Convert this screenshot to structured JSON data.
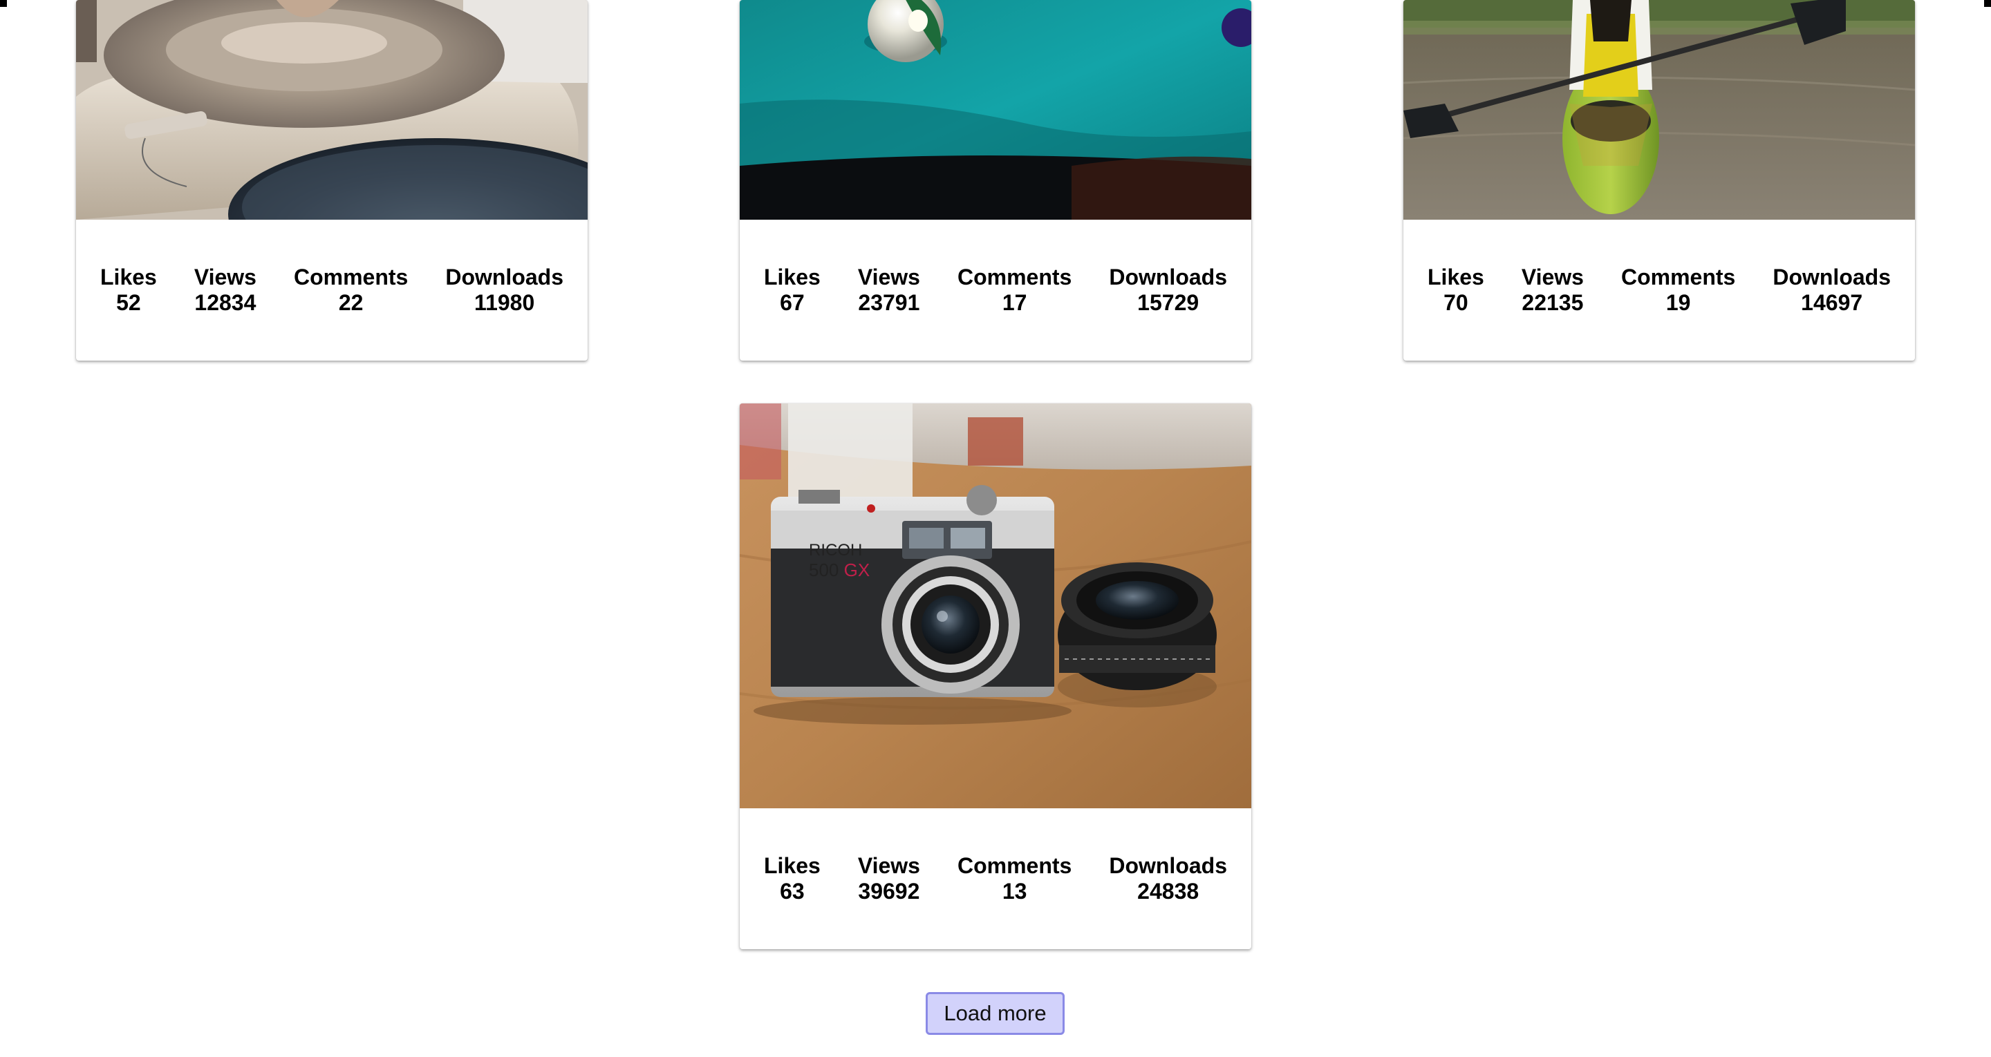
{
  "cards": [
    {
      "image_alt": "Pottery wheel with clay",
      "stats": [
        {
          "label": "Likes",
          "value": "52"
        },
        {
          "label": "Views",
          "value": "12834"
        },
        {
          "label": "Comments",
          "value": "22"
        },
        {
          "label": "Downloads",
          "value": "11980"
        }
      ]
    },
    {
      "image_alt": "Billiard balls on teal pool table",
      "stats": [
        {
          "label": "Likes",
          "value": "67"
        },
        {
          "label": "Views",
          "value": "23791"
        },
        {
          "label": "Comments",
          "value": "17"
        },
        {
          "label": "Downloads",
          "value": "15729"
        }
      ]
    },
    {
      "image_alt": "Person paddling a green kayak",
      "stats": [
        {
          "label": "Likes",
          "value": "70"
        },
        {
          "label": "Views",
          "value": "22135"
        },
        {
          "label": "Comments",
          "value": "19"
        },
        {
          "label": "Downloads",
          "value": "14697"
        }
      ]
    },
    {
      "image_alt": "Vintage camera and lens on wooden table",
      "camera_brand": "RICOH",
      "camera_model": "500",
      "camera_model_suffix": "GX",
      "stats": [
        {
          "label": "Likes",
          "value": "63"
        },
        {
          "label": "Views",
          "value": "39692"
        },
        {
          "label": "Comments",
          "value": "13"
        },
        {
          "label": "Downloads",
          "value": "24838"
        }
      ]
    }
  ],
  "load_more": {
    "label": "Load more"
  }
}
